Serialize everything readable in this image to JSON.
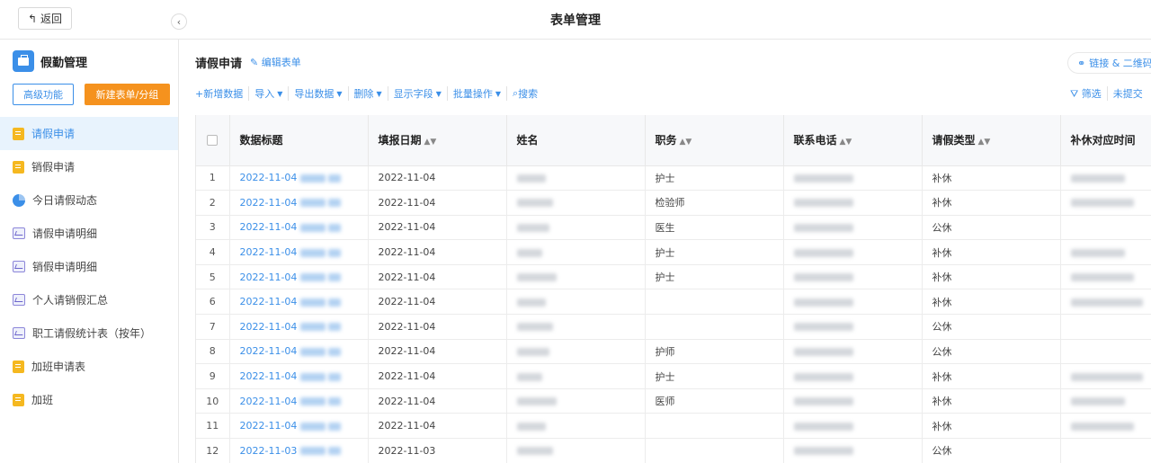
{
  "topbar": {
    "back_label": "返回",
    "title": "表单管理"
  },
  "sidebar": {
    "app_name": "假勤管理",
    "advanced_label": "高级功能",
    "new_label": "新建表单/分组",
    "items": [
      {
        "label": "请假申请",
        "icon": "form-icon",
        "active": true
      },
      {
        "label": "销假申请",
        "icon": "form-icon"
      },
      {
        "label": "今日请假动态",
        "icon": "pie-chart-icon"
      },
      {
        "label": "请假申请明细",
        "icon": "report-icon"
      },
      {
        "label": "销假申请明细",
        "icon": "report-icon"
      },
      {
        "label": "个人请销假汇总",
        "icon": "report-icon"
      },
      {
        "label": "职工请假统计表（按年）",
        "icon": "report-icon"
      },
      {
        "label": "加班申请表",
        "icon": "form-icon"
      },
      {
        "label": "加班",
        "icon": "form-icon"
      }
    ]
  },
  "main": {
    "title": "请假申请",
    "edit_form": "编辑表单",
    "link_qr": "链接 & 二维码",
    "toolbar": {
      "add": "新增数据",
      "import": "导入",
      "export": "导出数据",
      "delete": "删除",
      "show_fields": "显示字段",
      "batch": "批量操作",
      "search": "搜索"
    },
    "right_tools": {
      "filter": "筛选",
      "unsubmitted": "未提交"
    }
  },
  "table": {
    "columns": [
      "数据标题",
      "填报日期",
      "姓名",
      "职务",
      "联系电话",
      "请假类型",
      "补休对应时间"
    ],
    "rows": [
      {
        "n": "1",
        "title_date": "2022-11-04",
        "date": "2022-11-04",
        "role": "护士",
        "type": "补休",
        "has_comp": true
      },
      {
        "n": "2",
        "title_date": "2022-11-04",
        "date": "2022-11-04",
        "role": "检验师",
        "type": "补休",
        "has_comp": true
      },
      {
        "n": "3",
        "title_date": "2022-11-04",
        "date": "2022-11-04",
        "role": "医生",
        "type": "公休",
        "has_comp": false
      },
      {
        "n": "4",
        "title_date": "2022-11-04",
        "date": "2022-11-04",
        "role": "护士",
        "type": "补休",
        "has_comp": true
      },
      {
        "n": "5",
        "title_date": "2022-11-04",
        "date": "2022-11-04",
        "role": "护士",
        "type": "补休",
        "has_comp": true
      },
      {
        "n": "6",
        "title_date": "2022-11-04",
        "date": "2022-11-04",
        "role": "",
        "type": "补休",
        "has_comp": true
      },
      {
        "n": "7",
        "title_date": "2022-11-04",
        "date": "2022-11-04",
        "role": "",
        "type": "公休",
        "has_comp": false
      },
      {
        "n": "8",
        "title_date": "2022-11-04",
        "date": "2022-11-04",
        "role": "护师",
        "type": "公休",
        "has_comp": false
      },
      {
        "n": "9",
        "title_date": "2022-11-04",
        "date": "2022-11-04",
        "role": "护士",
        "type": "补休",
        "has_comp": true
      },
      {
        "n": "10",
        "title_date": "2022-11-04",
        "date": "2022-11-04",
        "role": "医师",
        "type": "补休",
        "has_comp": true
      },
      {
        "n": "11",
        "title_date": "2022-11-04",
        "date": "2022-11-04",
        "role": "",
        "type": "补休",
        "has_comp": true
      },
      {
        "n": "12",
        "title_date": "2022-11-03",
        "date": "2022-11-03",
        "role": "",
        "type": "公休",
        "has_comp": false
      }
    ]
  },
  "colors": {
    "accent": "#3b8fe8",
    "orange": "#f5921e"
  }
}
